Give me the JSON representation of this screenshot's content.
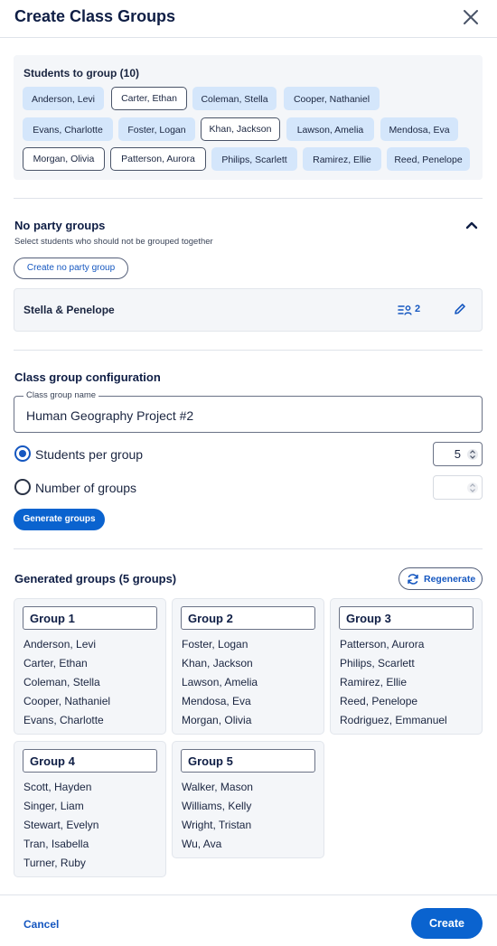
{
  "header": {
    "title": "Create Class Groups"
  },
  "students": {
    "label": "Students to group (10)",
    "chips": [
      "Anderson, Levi",
      "Carter, Ethan",
      "Coleman, Stella",
      "Cooper, Nathaniel",
      "Evans, Charlotte",
      "Foster, Logan",
      "Khan, Jackson",
      "Lawson, Amelia",
      "Mendosa, Eva",
      "Morgan, Olivia",
      "Patterson, Aurora",
      "Philips, Scarlett",
      "Ramirez, Ellie",
      "Reed, Penelope"
    ]
  },
  "no_party": {
    "title": "No party groups",
    "subtitle": "Select students who should not be grouped together",
    "create_label": "Create no party group",
    "groups": [
      {
        "name": "Stella & Penelope",
        "count": "2"
      }
    ]
  },
  "config": {
    "title": "Class group configuration",
    "name_label": "Class group name",
    "name_value": "Human Geography Project #2",
    "per_group_label": "Students per group",
    "per_group_value": "5",
    "num_groups_label": "Number of groups",
    "num_groups_value": "",
    "generate_label": "Generate groups"
  },
  "generated": {
    "title": "Generated groups (5 groups)",
    "regenerate_label": "Regenerate",
    "groups": [
      {
        "name": "Group 1",
        "members": [
          "Anderson, Levi",
          "Carter, Ethan",
          "Coleman, Stella",
          "Cooper, Nathaniel",
          "Evans, Charlotte"
        ]
      },
      {
        "name": "Group 2",
        "members": [
          "Foster, Logan",
          "Khan, Jackson",
          "Lawson, Amelia",
          "Mendosa, Eva",
          "Morgan, Olivia"
        ]
      },
      {
        "name": "Group 3",
        "members": [
          "Patterson, Aurora",
          "Philips, Scarlett",
          "Ramirez, Ellie",
          "Reed, Penelope",
          "Rodriguez, Emmanuel"
        ]
      },
      {
        "name": "Group 4",
        "members": [
          "Scott, Hayden",
          "Singer, Liam",
          "Stewart, Evelyn",
          "Tran, Isabella",
          "Turner, Ruby"
        ]
      },
      {
        "name": "Group 5",
        "members": [
          "Walker, Mason",
          "Williams, Kelly",
          "Wright, Tristan",
          "Wu, Ava"
        ]
      }
    ]
  },
  "footer": {
    "cancel_label": "Cancel",
    "create_label": "Create"
  },
  "colors": {
    "primary": "#0a63cf",
    "link": "#1557c0",
    "chip_fill": "#d4e6fb",
    "panel": "#f4f6f9",
    "title": "#0f1e45"
  },
  "icons": [
    "close-icon",
    "chevron-up-icon",
    "people-list-icon",
    "edit-pencil-icon",
    "refresh-icon",
    "stepper-arrows-icon"
  ]
}
